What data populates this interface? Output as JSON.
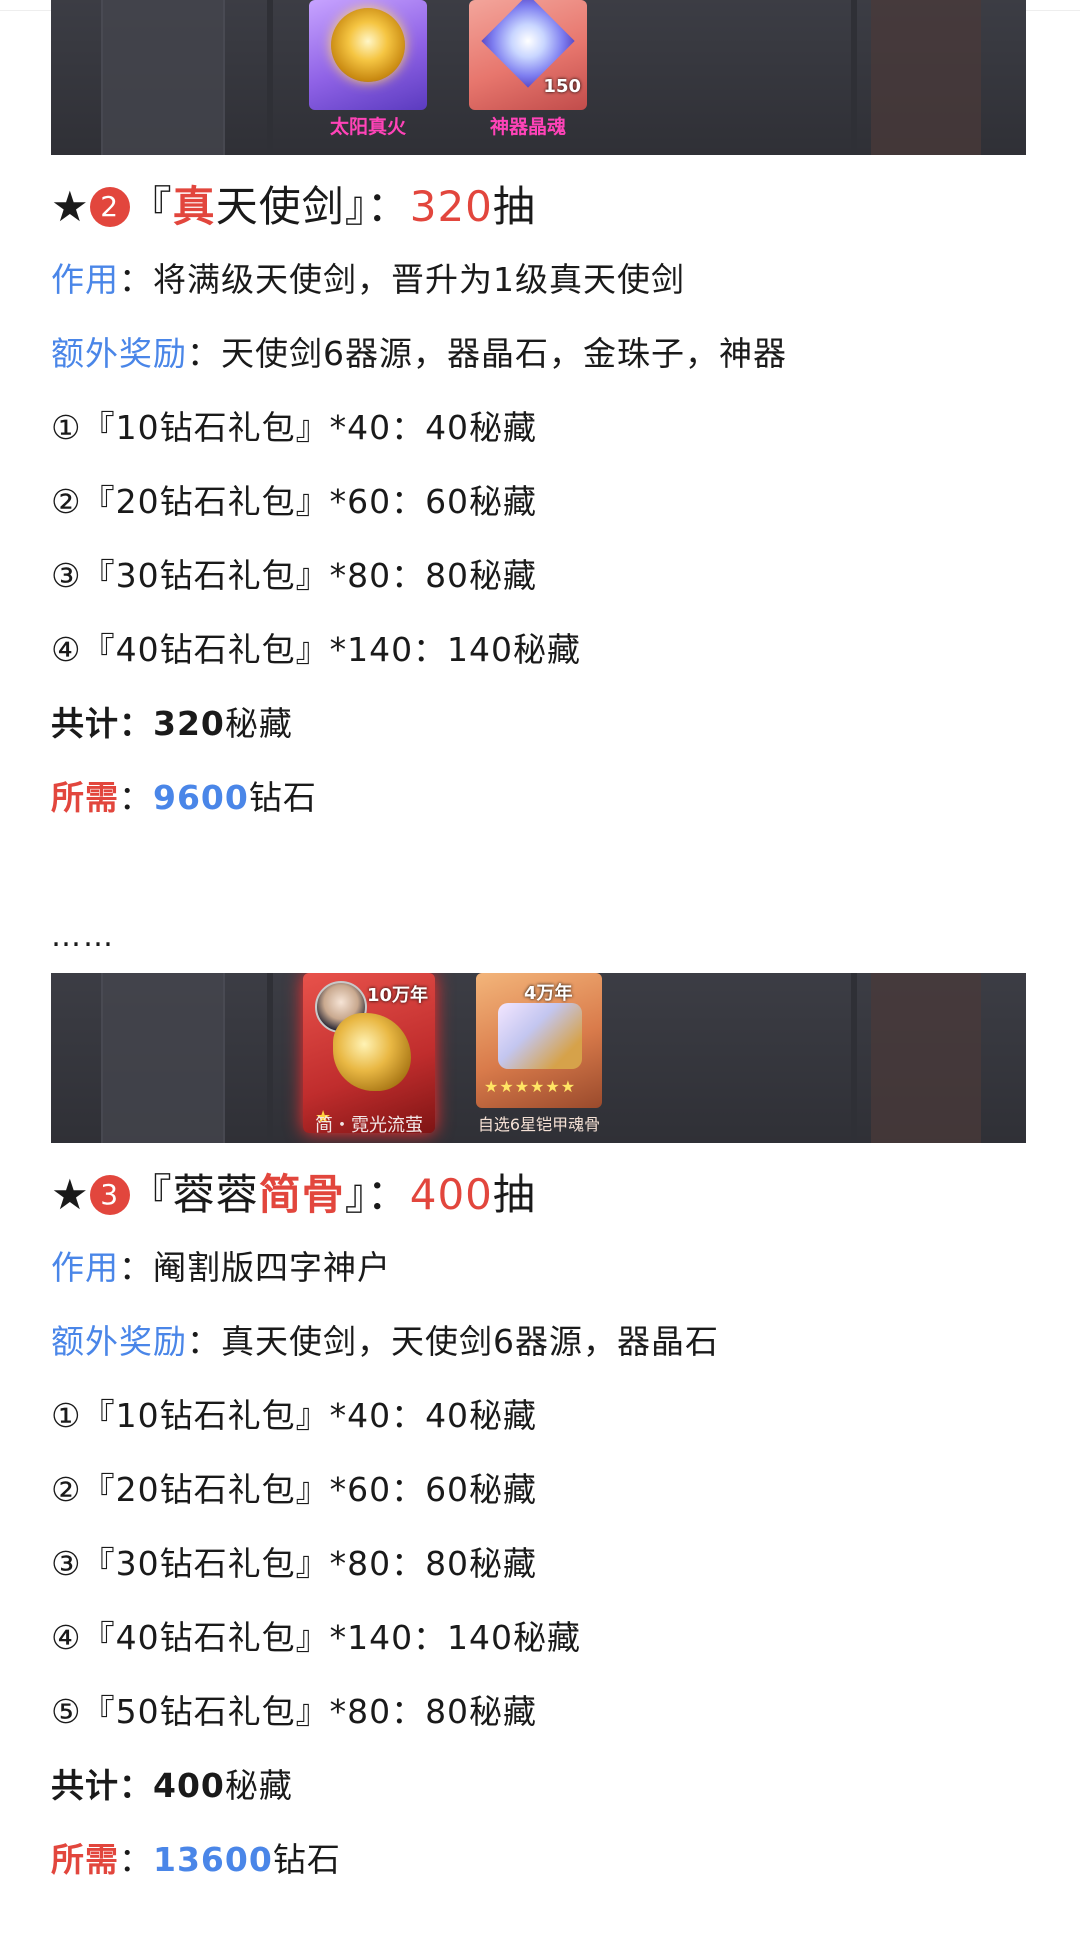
{
  "banner1": {
    "item1": {
      "caption": "太阳真火"
    },
    "item2": {
      "caption": "神器晶魂",
      "count": "150"
    }
  },
  "section2": {
    "star": "★",
    "number": "2",
    "open_bracket": "『",
    "title_highlight": "真",
    "title_rest": "天使剑",
    "close_bracket": "』：",
    "count": "320",
    "count_suffix": "抽",
    "effect_label": "作用",
    "effect_text": "：将满级天使剑，晋升为1级真天使剑",
    "bonus_label": "额外奖励",
    "bonus_text": "：天使剑6器源，器晶石，金珠子，神器",
    "packs": [
      "①『10钻石礼包』*40：40秘藏",
      "②『20钻石礼包』*60：60秘藏",
      "③『30钻石礼包』*80：80秘藏",
      "④『40钻石礼包』*140：140秘藏"
    ],
    "total_label": "共计",
    "total_value": "：320",
    "total_unit": "秘藏",
    "need_label": "所需",
    "need_sep": "：",
    "need_value": "9600",
    "need_unit": "钻石"
  },
  "ellipsis": "……",
  "banner2": {
    "item1": {
      "caption": "简・霓光流萤",
      "badge": "10万年"
    },
    "item2": {
      "caption": "自选6星铠甲魂骨",
      "badge": "4万年",
      "stars": "★★★★★★"
    }
  },
  "section3": {
    "star": "★",
    "number": "3",
    "open_bracket": "『",
    "title_rest": "蓉蓉",
    "title_highlight": "简骨",
    "close_bracket": "』：",
    "count": "400",
    "count_suffix": "抽",
    "effect_label": "作用",
    "effect_text": "：阉割版四字神户",
    "bonus_label": "额外奖励",
    "bonus_text": "：真天使剑，天使剑6器源，器晶石",
    "packs": [
      "①『10钻石礼包』*40：40秘藏",
      "②『20钻石礼包』*60：60秘藏",
      "③『30钻石礼包』*80：80秘藏",
      "④『40钻石礼包』*140：140秘藏",
      "⑤『50钻石礼包』*80：80秘藏"
    ],
    "total_label": "共计",
    "total_value": "：400",
    "total_unit": "秘藏",
    "need_label": "所需",
    "need_sep": "：",
    "need_value": "13600",
    "need_unit": "钻石"
  }
}
